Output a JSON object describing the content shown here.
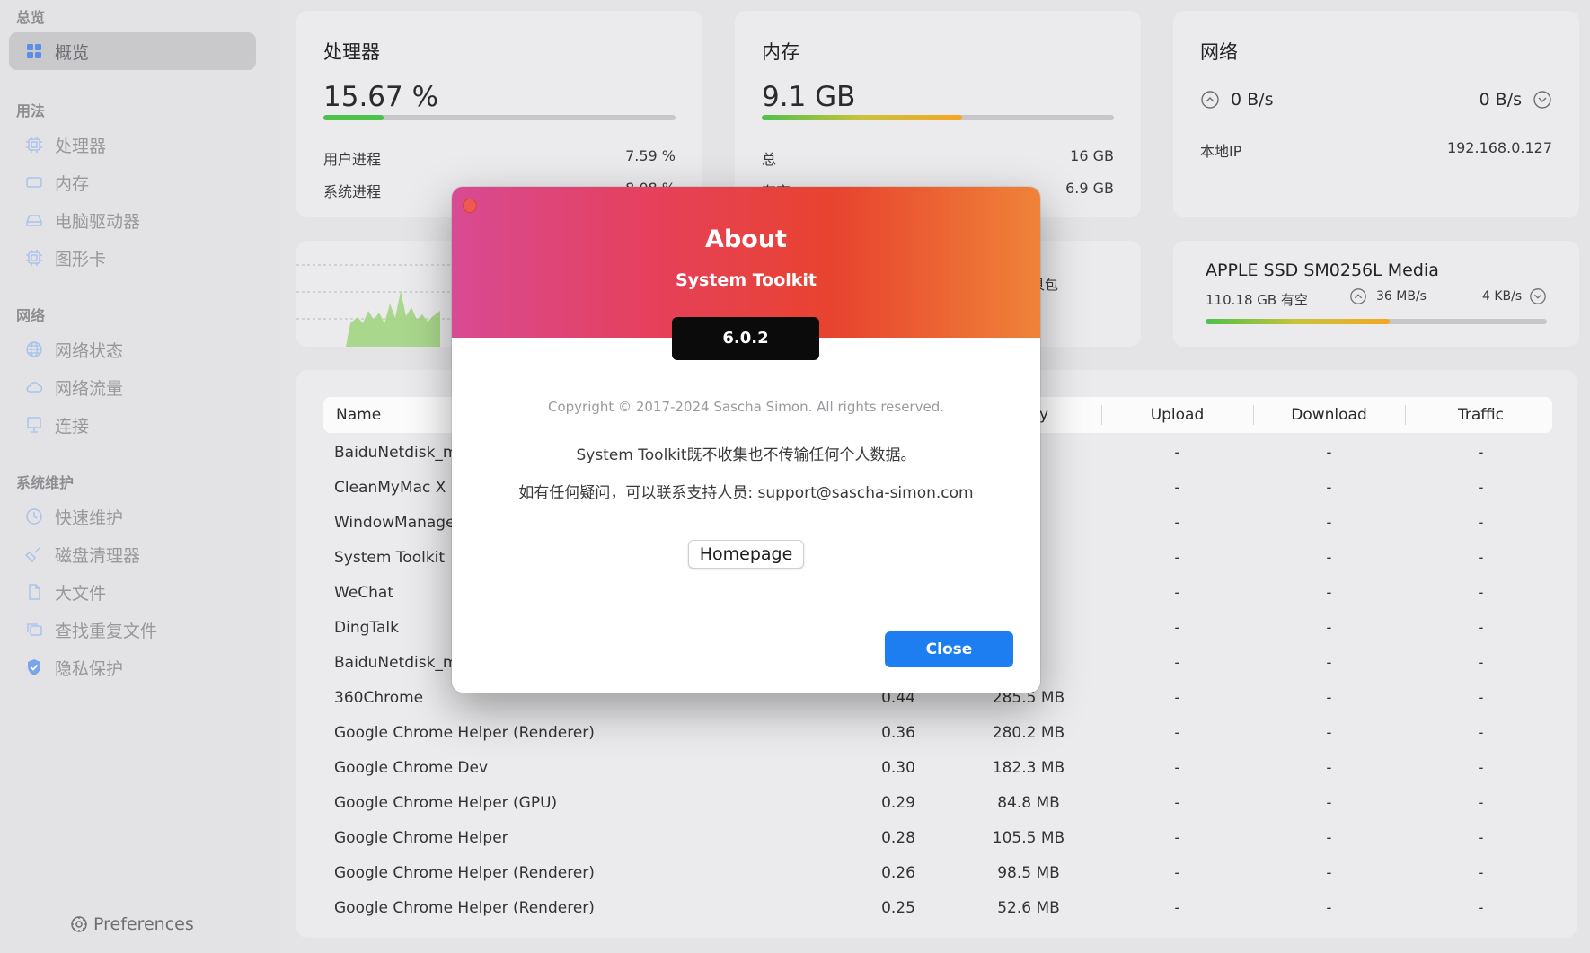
{
  "sidebar": {
    "sections": [
      "总览",
      "用法",
      "网络",
      "系统维护"
    ],
    "items": [
      {
        "label": "概览",
        "icon": "grid-icon"
      },
      {
        "label": "处理器",
        "icon": "cpu-icon"
      },
      {
        "label": "内存",
        "icon": "memory-icon"
      },
      {
        "label": "电脑驱动器",
        "icon": "drive-icon"
      },
      {
        "label": "图形卡",
        "icon": "gpu-icon"
      },
      {
        "label": "网络状态",
        "icon": "globe-icon"
      },
      {
        "label": "网络流量",
        "icon": "cloud-icon"
      },
      {
        "label": "连接",
        "icon": "monitor-icon"
      },
      {
        "label": "快速维护",
        "icon": "clock-icon"
      },
      {
        "label": "磁盘清理器",
        "icon": "broom-icon"
      },
      {
        "label": "大文件",
        "icon": "file-icon"
      },
      {
        "label": "查找重复文件",
        "icon": "duplicate-icon"
      },
      {
        "label": "隐私保护",
        "icon": "shield-icon"
      }
    ],
    "preferences": "Preferences"
  },
  "cpu": {
    "title": "处理器",
    "value": "15.67 %",
    "usage_fraction": 0.17,
    "user_label": "用户进程",
    "user_value": "7.59 %",
    "system_label": "系统进程",
    "system_value": "8.08 %"
  },
  "memory": {
    "title": "内存",
    "value": "9.1 GB",
    "usage_fraction": 0.57,
    "total_label": "总",
    "total_value": "16 GB",
    "free_label": "有空",
    "free_value": "6.9 GB"
  },
  "network": {
    "title": "网络",
    "upload": "0 B/s",
    "download": "0 B/s",
    "ip_label": "本地IP",
    "ip_value": "192.168.0.127"
  },
  "disk": {
    "name": "APPLE SSD SM0256L Media",
    "free": "110.18 GB 有空",
    "read": "36 MB/s",
    "write": "4 KB/s",
    "usage_fraction": 0.54
  },
  "middle_card_text": "具包",
  "table": {
    "headers": {
      "name": "Name",
      "memory": "ry",
      "upload": "Upload",
      "download": "Download",
      "traffic": "Traffic"
    },
    "rows": [
      {
        "name": "BaiduNetdisk_ma",
        "cpu": "",
        "memory": "MB",
        "upload": "-",
        "download": "-",
        "traffic": "-"
      },
      {
        "name": "CleanMyMac X H",
        "cpu": "",
        "memory": "MB",
        "upload": "-",
        "download": "-",
        "traffic": "-"
      },
      {
        "name": "WindowManager",
        "cpu": "",
        "memory": "MB",
        "upload": "-",
        "download": "-",
        "traffic": "-"
      },
      {
        "name": "System Toolkit",
        "cpu": "",
        "memory": "B",
        "upload": "-",
        "download": "-",
        "traffic": "-"
      },
      {
        "name": "WeChat",
        "cpu": "",
        "memory": "MB",
        "upload": "-",
        "download": "-",
        "traffic": "-"
      },
      {
        "name": "DingTalk",
        "cpu": "",
        "memory": "MB",
        "upload": "-",
        "download": "-",
        "traffic": "-"
      },
      {
        "name": "BaiduNetdisk_ma",
        "cpu": "",
        "memory": "MB",
        "upload": "-",
        "download": "-",
        "traffic": "-"
      },
      {
        "name": "360Chrome",
        "cpu": "0.44",
        "memory": "285.5 MB",
        "upload": "-",
        "download": "-",
        "traffic": "-"
      },
      {
        "name": "Google Chrome Helper (Renderer)",
        "cpu": "0.36",
        "memory": "280.2 MB",
        "upload": "-",
        "download": "-",
        "traffic": "-"
      },
      {
        "name": "Google Chrome Dev",
        "cpu": "0.30",
        "memory": "182.3 MB",
        "upload": "-",
        "download": "-",
        "traffic": "-"
      },
      {
        "name": "Google Chrome Helper (GPU)",
        "cpu": "0.29",
        "memory": "84.8 MB",
        "upload": "-",
        "download": "-",
        "traffic": "-"
      },
      {
        "name": "Google Chrome Helper",
        "cpu": "0.28",
        "memory": "105.5 MB",
        "upload": "-",
        "download": "-",
        "traffic": "-"
      },
      {
        "name": "Google Chrome Helper (Renderer)",
        "cpu": "0.26",
        "memory": "98.5 MB",
        "upload": "-",
        "download": "-",
        "traffic": "-"
      },
      {
        "name": "Google Chrome Helper (Renderer)",
        "cpu": "0.25",
        "memory": "52.6 MB",
        "upload": "-",
        "download": "-",
        "traffic": "-"
      }
    ]
  },
  "about": {
    "title": "About",
    "app_name": "System Toolkit",
    "version": "6.0.2",
    "copyright": "Copyright © 2017-2024 Sascha Simon. All rights reserved.",
    "privacy": "System Toolkit既不收集也不传输任何个人数据。",
    "contact": "如有任何疑问，可以联系支持人员: support@sascha-simon.com",
    "homepage_label": "Homepage",
    "close_label": "Close"
  },
  "colors": {
    "accent": "#1d7ef2",
    "gradient_start": "#d84a93",
    "gradient_mid": "#e8432e",
    "gradient_end": "#ef8338",
    "bar_green": "#4cc24a",
    "bar_orange": "#f5a623"
  }
}
